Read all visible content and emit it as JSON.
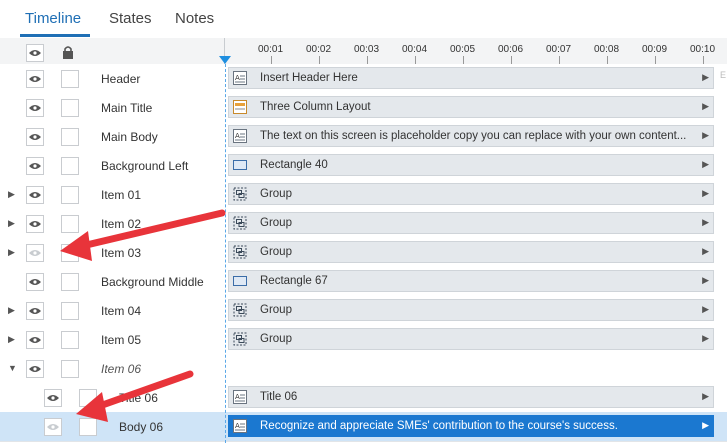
{
  "tabs": [
    {
      "label": "Timeline",
      "active": true
    },
    {
      "label": "States",
      "active": false
    },
    {
      "label": "Notes",
      "active": false
    }
  ],
  "ruler": {
    "ticks": [
      "00:01",
      "00:02",
      "00:03",
      "00:04",
      "00:05",
      "00:06",
      "00:07",
      "00:08",
      "00:09",
      "00:10"
    ]
  },
  "rows": [
    {
      "name": "Header",
      "expander": "",
      "italic": false,
      "bar": "Insert Header Here",
      "icon": "text-icon",
      "eye": "visible"
    },
    {
      "name": "Main Title",
      "expander": "",
      "italic": false,
      "bar": "Three Column Layout",
      "icon": "title-icon",
      "eye": "visible"
    },
    {
      "name": "Main Body",
      "expander": "",
      "italic": false,
      "bar": "The text on this screen is placeholder copy you can replace with your own content...",
      "icon": "text-icon",
      "eye": "visible"
    },
    {
      "name": "Background Left",
      "expander": "",
      "italic": false,
      "bar": "Rectangle 40",
      "icon": "rectangle-icon",
      "eye": "visible"
    },
    {
      "name": "Item 01",
      "expander": "collapsed",
      "italic": false,
      "bar": "Group",
      "icon": "group-icon",
      "eye": "visible"
    },
    {
      "name": "Item 02",
      "expander": "collapsed",
      "italic": false,
      "bar": "Group",
      "icon": "group-icon",
      "eye": "visible"
    },
    {
      "name": "Item 03",
      "expander": "collapsed",
      "italic": false,
      "bar": "Group",
      "icon": "group-icon",
      "eye": "hidden"
    },
    {
      "name": "Background Middle",
      "expander": "",
      "italic": false,
      "bar": "Rectangle 67",
      "icon": "rectangle-icon",
      "eye": "visible"
    },
    {
      "name": "Item 04",
      "expander": "collapsed",
      "italic": false,
      "bar": "Group",
      "icon": "group-icon",
      "eye": "visible"
    },
    {
      "name": "Item 05",
      "expander": "collapsed",
      "italic": false,
      "bar": "Group",
      "icon": "group-icon",
      "eye": "visible"
    },
    {
      "name": "Item 06",
      "expander": "expanded",
      "italic": true,
      "bar": "",
      "icon": "",
      "eye": "visible"
    },
    {
      "name": "Title 06",
      "expander": "",
      "italic": false,
      "bar": "Title 06",
      "icon": "text-icon",
      "eye": "visible",
      "child": true
    },
    {
      "name": "Body 06",
      "expander": "",
      "italic": false,
      "bar": "Recognize and appreciate SMEs' contribution to the course's success.",
      "icon": "text-icon",
      "eye": "hidden",
      "child": true,
      "selected": true
    }
  ],
  "colors": {
    "accent": "#1f6fb5",
    "selection": "#1b78d0",
    "arrow": "#e8343a"
  },
  "edge_letter": "E"
}
